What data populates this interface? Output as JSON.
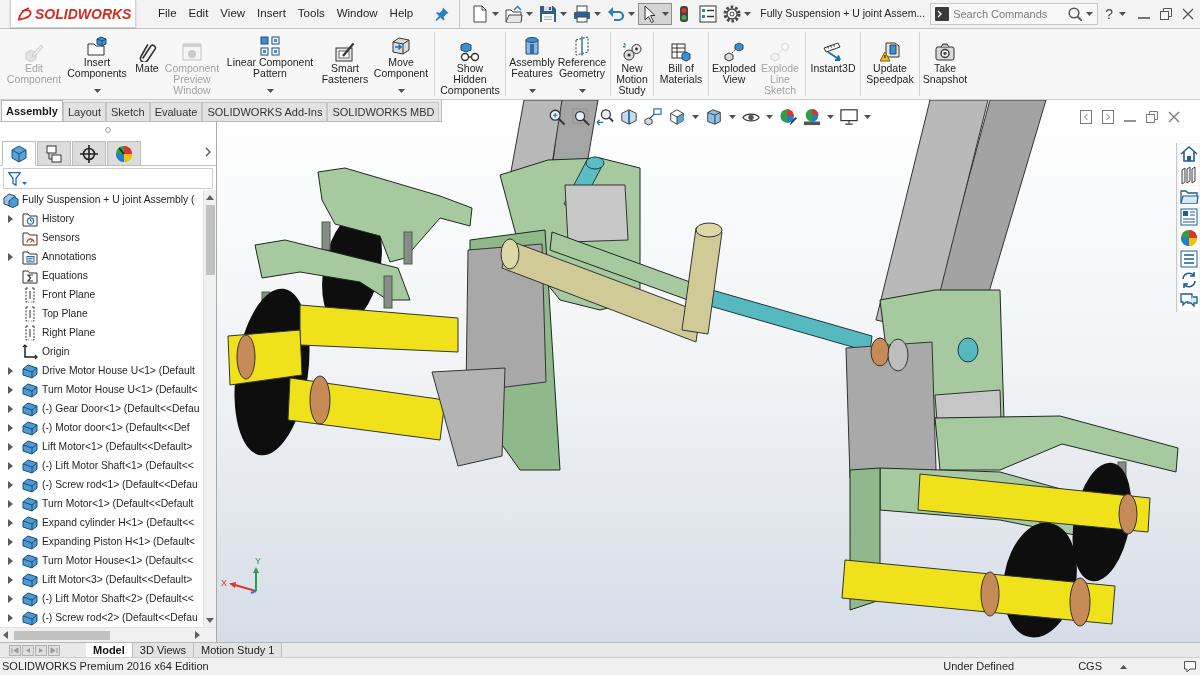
{
  "logo": {
    "text": "SOLIDWORKS"
  },
  "menu": [
    "File",
    "Edit",
    "View",
    "Insert",
    "Tools",
    "Window",
    "Help"
  ],
  "quick_access": [
    {
      "dropdown": true,
      "selected": false
    },
    {
      "dropdown": true,
      "selected": false
    },
    {
      "dropdown": true,
      "selected": false
    },
    {
      "dropdown": true,
      "selected": false
    },
    {
      "dropdown": true,
      "selected": false
    },
    {
      "dropdown": true,
      "selected": true
    },
    {
      "dropdown": false,
      "selected": false
    },
    {
      "dropdown": false,
      "selected": false
    },
    {
      "dropdown": true,
      "selected": false
    }
  ],
  "document_title": "Fully Suspension + U joint Assem...",
  "search": {
    "placeholder": "Search Commands"
  },
  "help": {
    "label": "?"
  },
  "ribbon_groups": [
    [
      {
        "label": "Edit\nComponent",
        "disabled": true,
        "dropdown": false
      },
      {
        "label": "Insert\nComponents",
        "disabled": false,
        "dropdown": true
      },
      {
        "label": "Mate",
        "disabled": false,
        "dropdown": false
      },
      {
        "label": "Component\nPreview\nWindow",
        "disabled": true,
        "dropdown": false
      },
      {
        "label": "Linear Component\nPattern",
        "disabled": false,
        "dropdown": true
      },
      {
        "label": "Smart\nFasteners",
        "disabled": false,
        "dropdown": false
      },
      {
        "label": "Move\nComponent",
        "disabled": false,
        "dropdown": true
      }
    ],
    [
      {
        "label": "Show\nHidden\nComponents",
        "disabled": false,
        "dropdown": false
      }
    ],
    [
      {
        "label": "Assembly\nFeatures",
        "disabled": false,
        "dropdown": true
      },
      {
        "label": "Reference\nGeometry",
        "disabled": false,
        "dropdown": true
      }
    ],
    [
      {
        "label": "New\nMotion\nStudy",
        "disabled": false,
        "dropdown": false
      }
    ],
    [
      {
        "label": "Bill of\nMaterials",
        "disabled": false,
        "dropdown": false
      }
    ],
    [
      {
        "label": "Exploded\nView",
        "disabled": false,
        "dropdown": false
      },
      {
        "label": "Explode\nLine\nSketch",
        "disabled": true,
        "dropdown": false
      }
    ],
    [
      {
        "label": "Instant3D",
        "disabled": false,
        "dropdown": false
      }
    ],
    [
      {
        "label": "Update\nSpeedpak",
        "disabled": false,
        "dropdown": false
      }
    ],
    [
      {
        "label": "Take\nSnapshot",
        "disabled": false,
        "dropdown": false
      }
    ]
  ],
  "command_tabs": [
    {
      "label": "Assembly",
      "selected": true
    },
    {
      "label": "Layout",
      "selected": false
    },
    {
      "label": "Sketch",
      "selected": false
    },
    {
      "label": "Evaluate",
      "selected": false
    },
    {
      "label": "SOLIDWORKS Add-Ins",
      "selected": false
    },
    {
      "label": "SOLIDWORKS MBD",
      "selected": false
    }
  ],
  "panel_tabs": [
    {
      "selected": true
    },
    {
      "selected": false
    },
    {
      "selected": false
    },
    {
      "selected": false
    }
  ],
  "feature_tree": {
    "label": "Fully Suspension + U joint Assembly (",
    "children": [
      {
        "label": "History",
        "kind": "history",
        "expandable": true
      },
      {
        "label": "Sensors",
        "kind": "sensors",
        "expandable": false
      },
      {
        "label": "Annotations",
        "kind": "annotations",
        "expandable": true
      },
      {
        "label": "Equations",
        "kind": "equations",
        "expandable": false
      },
      {
        "label": "Front Plane",
        "kind": "plane",
        "expandable": false
      },
      {
        "label": "Top Plane",
        "kind": "plane",
        "expandable": false
      },
      {
        "label": "Right Plane",
        "kind": "plane",
        "expandable": false
      },
      {
        "label": "Origin",
        "kind": "origin",
        "expandable": false
      },
      {
        "label": "Drive Motor House U<1> (Default",
        "kind": "part",
        "expandable": true
      },
      {
        "label": "Turn Motor House U<1> (Default<",
        "kind": "part",
        "expandable": true
      },
      {
        "label": "(-) Gear Door<1> (Default<<Defau",
        "kind": "part",
        "expandable": true
      },
      {
        "label": "(-) Motor door<1> (Default<<Def",
        "kind": "part",
        "expandable": true
      },
      {
        "label": "Lift Motor<1> (Default<<Default>",
        "kind": "part",
        "expandable": true
      },
      {
        "label": "(-) Lift Motor Shaft<1> (Default<<",
        "kind": "part",
        "expandable": true
      },
      {
        "label": "(-) Screw rod<1> (Default<<Defau",
        "kind": "part",
        "expandable": true
      },
      {
        "label": "Turn Motor<1> (Default<<Default",
        "kind": "part",
        "expandable": true
      },
      {
        "label": "Expand cylinder H<1> (Default<<",
        "kind": "part",
        "expandable": true
      },
      {
        "label": "Expanding Piston H<1> (Default<",
        "kind": "part",
        "expandable": true
      },
      {
        "label": "Turn Motor House<1> (Default<<",
        "kind": "part",
        "expandable": true
      },
      {
        "label": "Lift Motor<3> (Default<<Default>",
        "kind": "part",
        "expandable": true
      },
      {
        "label": "(-) Lift Motor Shaft<2> (Default<<",
        "kind": "part",
        "expandable": true
      },
      {
        "label": "(-) Screw rod<2> (Default<<Defau",
        "kind": "part",
        "expandable": true
      }
    ]
  },
  "view_toolbar": [
    {
      "dropdown": false
    },
    {
      "dropdown": false
    },
    {
      "dropdown": false
    },
    {
      "dropdown": false
    },
    {
      "dropdown": false
    },
    {
      "dropdown": true
    },
    {
      "dropdown": true
    },
    {
      "dropdown": true
    },
    {
      "dropdown": false
    },
    {
      "dropdown": true
    },
    {
      "dropdown": true
    }
  ],
  "triad": {
    "x_label": "X",
    "y_label": "Y"
  },
  "bottom_tabs": [
    {
      "label": "Model",
      "selected": true
    },
    {
      "label": "3D Views",
      "selected": false
    },
    {
      "label": "Motion Study 1",
      "selected": false
    }
  ],
  "status_bar": {
    "edition": "SOLIDWORKS Premium 2016 x64 Edition",
    "state": "Under Defined",
    "units": "CGS"
  }
}
